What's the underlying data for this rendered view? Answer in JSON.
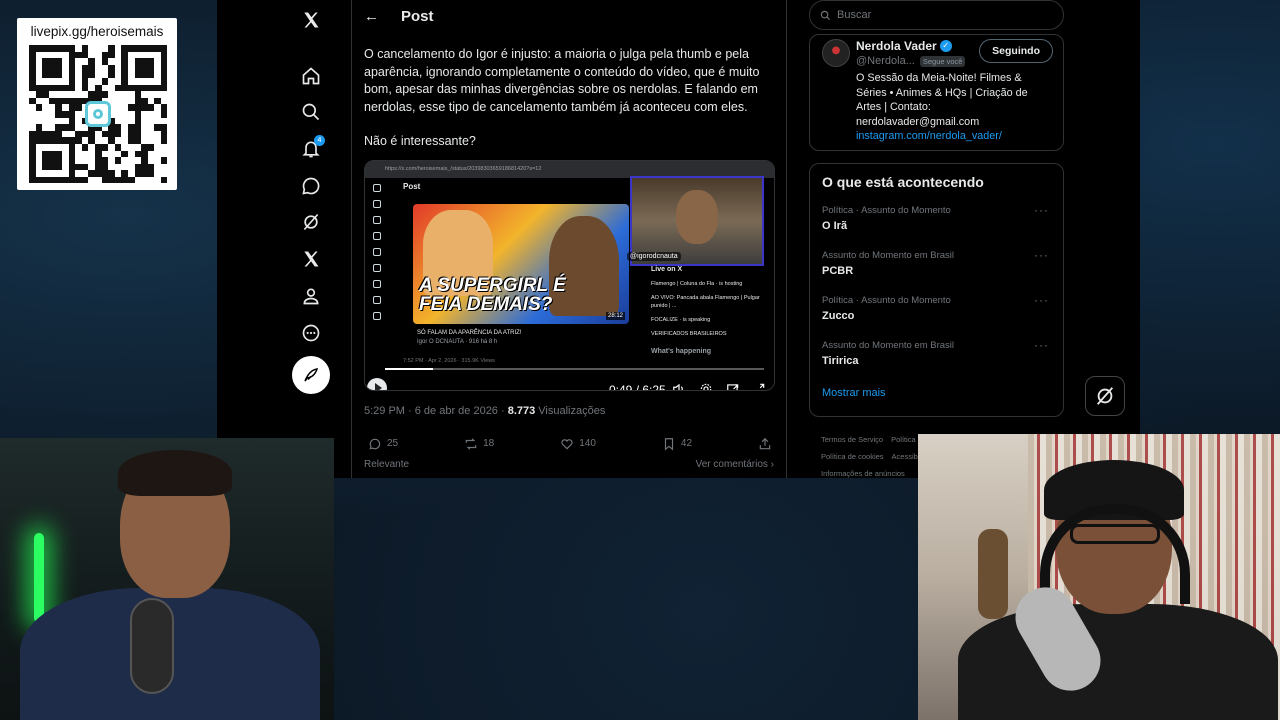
{
  "overlay": {
    "qr_label": "livepix.gg/heroisemais"
  },
  "nav": {
    "notification_count": "4"
  },
  "header": {
    "back_label": "←",
    "title": "Post"
  },
  "tweet": {
    "paragraph1": "O cancelamento do Igor é injusto: a maioria o julga pela thumb e pela aparência, ignorando completamente o conteúdo do vídeo, que é muito bom, apesar das minhas divergências sobre os nerdolas. E falando em nerdolas, esse tipo de cancelamento também já aconteceu com eles.",
    "paragraph2": "Não é interessante?",
    "timestamp": "5:29 PM · 6 de abr de 2026 · ",
    "views_count": "8.773",
    "views_label": " Visualizações",
    "replies": "25",
    "reposts": "18",
    "likes": "140",
    "bookmarks": "42",
    "sort_label": "Relevante",
    "see_replies_label": "Ver comentários ›"
  },
  "media": {
    "url": "https://x.com/heroisemais_/status/2039830365918681420?s=12",
    "embedded_post_title": "Post",
    "headline": "A SUPERGIRL É FEIA DEMAIS?",
    "thumb_duration": "28:12",
    "caption_title": "SÓ FALAM DA APARÊNCIA DA ATRIZ!",
    "caption_sub": "Igor O DCNAUTA · 916 há 8 h",
    "embedded_meta": "7:52 PM · Apr 2, 2026 · 315.9K Views",
    "handle": "@igorodcnauta",
    "live_header": "Live on X",
    "live_row1": "Flamengo | Coluna do Fla · is hosting",
    "live_row2": "AO VIVO: Pancada abala Flamengo | Pulgar punido | ...",
    "live_row3": "FOCALIZE · is speaking",
    "live_row4": "VERIFICADOS BRASILEIROS",
    "whats_happening": "What's happening",
    "time": "0:49 / 6:25",
    "progress": 0.127
  },
  "sidebar": {
    "search_placeholder": "Buscar",
    "profile_name": "Nerdola Vader",
    "profile_handle": "@Nerdola...",
    "follows_you": "Segue você",
    "following_button": "Seguindo",
    "bio": "O Sessão da Meia-Noite! Filmes & Séries • Animes & HQs | Criação de Artes | Contato: nerdolavader@gmail.com",
    "bio_link": "instagram.com/nerdola_vader/",
    "trends_title": "O que está acontecendo",
    "trends": [
      {
        "category": "Política · Assunto do Momento",
        "name": "O Irã"
      },
      {
        "category": "Assunto do Momento em Brasil",
        "name": "PCBR"
      },
      {
        "category": "Política · Assunto do Momento",
        "name": "Zucco"
      },
      {
        "category": "Assunto do Momento em Brasil",
        "name": "Tiririca"
      }
    ],
    "show_more": "Mostrar mais",
    "footer": [
      "Termos de Serviço",
      "Política de Privacidade",
      "Política de cookies",
      "Acessibilidade",
      "Informações de anúncios"
    ]
  },
  "colors": {
    "accent": "#1d9bf0",
    "background": "#000000",
    "border": "#2f3336",
    "muted_text": "#71767b"
  }
}
